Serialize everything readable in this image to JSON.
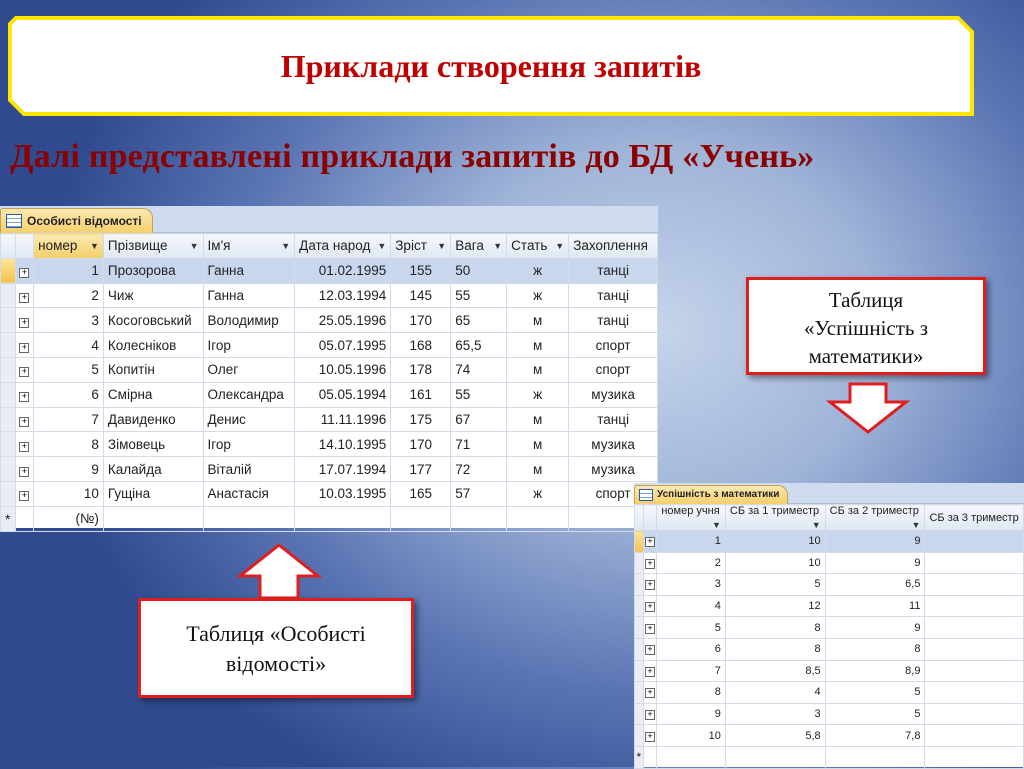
{
  "title": "Приклади створення запитів",
  "subtitle": "Далі представлені приклади запитів до БД «Учень»",
  "table1": {
    "tab": "Особисті відомості",
    "columns": [
      "номер",
      "Прізвище",
      "Ім'я",
      "Дата народ",
      "Зріст",
      "Вага",
      "Стать",
      "Захоплення"
    ],
    "rows": [
      [
        "1",
        "Прозорова",
        "Ганна",
        "01.02.1995",
        "155",
        "50",
        "ж",
        "танці"
      ],
      [
        "2",
        "Чиж",
        "Ганна",
        "12.03.1994",
        "145",
        "55",
        "ж",
        "танці"
      ],
      [
        "3",
        "Косоговський",
        "Володимир",
        "25.05.1996",
        "170",
        "65",
        "м",
        "танці"
      ],
      [
        "4",
        "Колесніков",
        "Ігор",
        "05.07.1995",
        "168",
        "65,5",
        "м",
        "спорт"
      ],
      [
        "5",
        "Копитін",
        "Олег",
        "10.05.1996",
        "178",
        "74",
        "м",
        "спорт"
      ],
      [
        "6",
        "Смірна",
        "Олександра",
        "05.05.1994",
        "161",
        "55",
        "ж",
        "музика"
      ],
      [
        "7",
        "Давиденко",
        "Денис",
        "11.11.1996",
        "175",
        "67",
        "м",
        "танці"
      ],
      [
        "8",
        "Зімовець",
        "Ігор",
        "14.10.1995",
        "170",
        "71",
        "м",
        "музика"
      ],
      [
        "9",
        "Калайда",
        "Віталій",
        "17.07.1994",
        "177",
        "72",
        "м",
        "музика"
      ],
      [
        "10",
        "Гущіна",
        "Анастасія",
        "10.03.1995",
        "165",
        "57",
        "ж",
        "спорт"
      ]
    ],
    "new_row_label": "(№)",
    "new_row_marker": "*"
  },
  "table2": {
    "tab": "Успішність з математики",
    "columns": [
      "номер учня",
      "СБ за 1 триместр",
      "СБ за 2 триместр",
      "СБ за 3 триместр"
    ],
    "rows": [
      [
        "1",
        "10",
        "9"
      ],
      [
        "2",
        "10",
        "9"
      ],
      [
        "3",
        "5",
        "6,5"
      ],
      [
        "4",
        "12",
        "11"
      ],
      [
        "5",
        "8",
        "9"
      ],
      [
        "6",
        "8",
        "8"
      ],
      [
        "7",
        "8,5",
        "8,9"
      ],
      [
        "8",
        "4",
        "5"
      ],
      [
        "9",
        "3",
        "5"
      ],
      [
        "10",
        "5,8",
        "7,8"
      ]
    ],
    "new_row_marker": "*"
  },
  "callout_right": {
    "line1": "Таблиця",
    "line2": "«Успішність з",
    "line3": "математики»"
  },
  "callout_left": {
    "line1": "Таблиця «Особисті",
    "line2": "відомості»"
  },
  "colors": {
    "title": "#c00000",
    "subtitle": "#8b0000",
    "border_red": "#e01e1e",
    "yellow": "#ffe600"
  }
}
